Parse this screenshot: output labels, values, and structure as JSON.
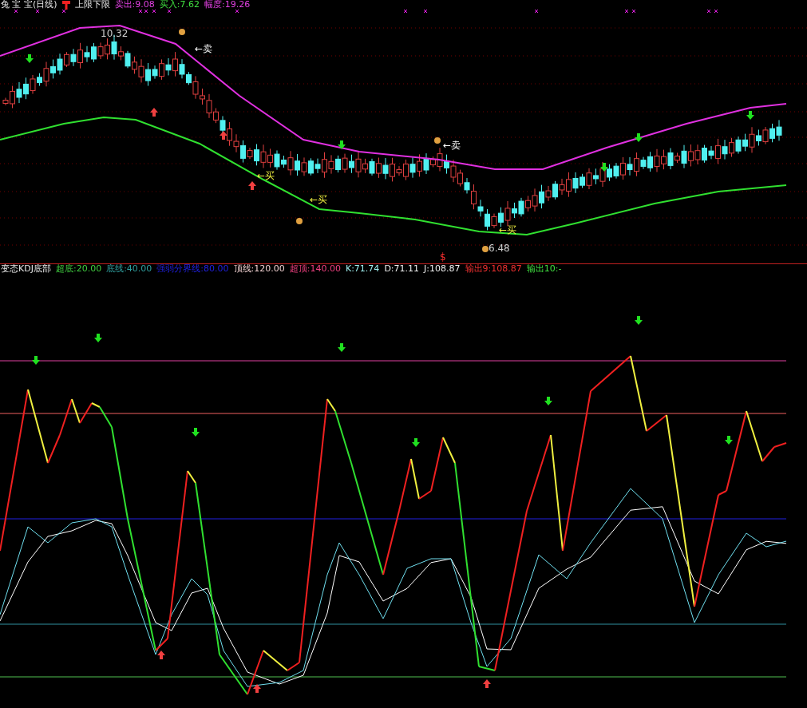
{
  "price_panel": {
    "title": "兔 宝 宝(日线)",
    "indicator": "上限下限",
    "readings": [
      {
        "text": "卖出:9.08",
        "color": "#e040e0"
      },
      {
        "text": "买入:7.62",
        "color": "#40e040"
      },
      {
        "text": "幅度:19.26",
        "color": "#e040e0"
      }
    ],
    "annotations": [
      {
        "text": "10.32",
        "kind": "price"
      },
      {
        "text": "←卖",
        "kind": "sell"
      },
      {
        "text": "←卖",
        "kind": "sell"
      },
      {
        "text": "←买",
        "kind": "buy"
      },
      {
        "text": "←买",
        "kind": "buy"
      },
      {
        "text": "←买",
        "kind": "buy"
      },
      {
        "text": "6.48",
        "kind": "price"
      },
      {
        "text": "$",
        "kind": "marker"
      }
    ]
  },
  "kdj_panel": {
    "title": "变态KDJ底部",
    "readings": [
      {
        "text": "超底:20.00",
        "color": "#40d040"
      },
      {
        "text": "底线:40.00",
        "color": "#30a0a0"
      },
      {
        "text": "强弱分界线:80.00",
        "color": "#2020e0"
      },
      {
        "text": "顶线:120.00",
        "color": "#f0d0d0"
      },
      {
        "text": "超顶:140.00",
        "color": "#f04080"
      },
      {
        "text": "K:71.74",
        "color": "#a0f0f0"
      },
      {
        "text": "D:71.11",
        "color": "#f0f0f0"
      },
      {
        "text": "J:108.87",
        "color": "#f0f0f0"
      },
      {
        "text": "输出9:108.87",
        "color": "#f03030"
      },
      {
        "text": "输出10:-",
        "color": "#40e040"
      }
    ]
  }
}
